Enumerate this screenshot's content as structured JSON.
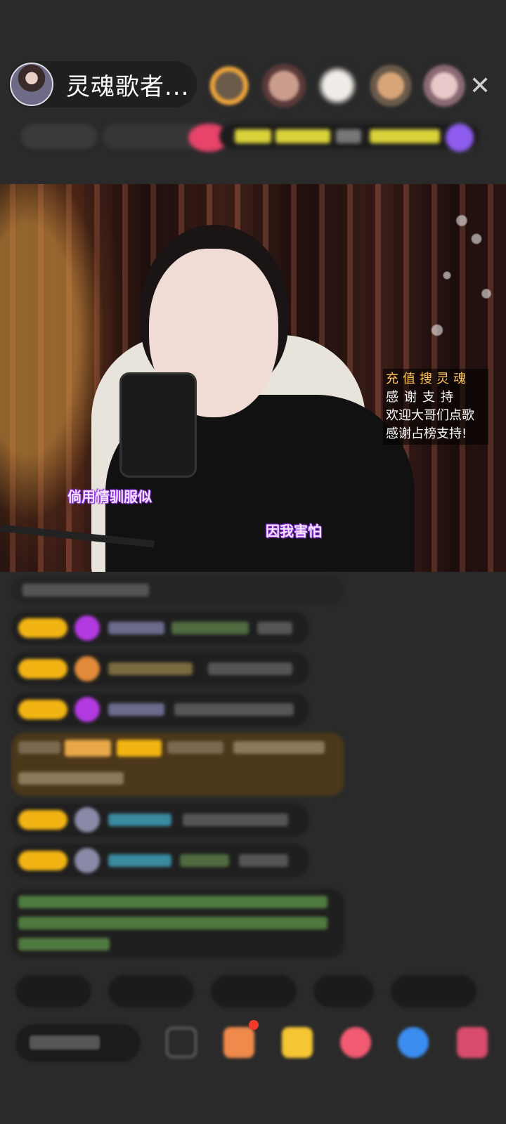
{
  "header": {
    "host_name": "灵魂歌者...",
    "close_icon": "close-icon"
  },
  "video": {
    "notice": {
      "title": "充值搜灵魂",
      "line2": "感谢支持",
      "line3": "欢迎大哥们点歌",
      "line4": "感谢占榜支持!"
    },
    "lyric_left": "倘用情驯服似",
    "lyric_right": "因我害怕"
  },
  "colors": {
    "background": "#2a2a2a",
    "badge_gold": "#f2b413",
    "highlight_message": "#4b3719",
    "lyric_purple": "#8a2be2",
    "notice_gold": "#ffc55c"
  }
}
